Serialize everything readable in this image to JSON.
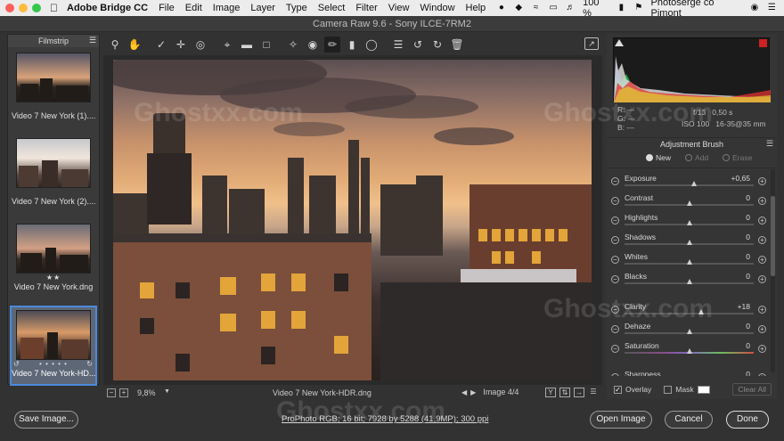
{
  "menubar": {
    "app_name": "Adobe Bridge CC",
    "items": [
      "File",
      "Edit",
      "Image",
      "Layer",
      "Type",
      "Select",
      "Filter",
      "View",
      "Window",
      "Help"
    ],
    "battery": "100 %",
    "user": "Photoserge co Pimont"
  },
  "window": {
    "title": "Camera Raw 9.6  -  Sony ILCE-7RM2"
  },
  "filmstrip": {
    "title": "Filmstrip",
    "items": [
      {
        "label": "Video 7 New York (1)....",
        "stars": ""
      },
      {
        "label": "Video 7 New York (2)....",
        "stars": ""
      },
      {
        "label": "Video 7 New York.dng",
        "stars": "★★"
      },
      {
        "label": "Video 7 New York-HD...",
        "stars": "• • • • •",
        "selected": true
      }
    ]
  },
  "toolbar": {
    "tools": [
      "zoom-icon",
      "hand-icon",
      "white-balance-icon",
      "color-sampler-icon",
      "targeted-adjust-icon",
      "crop-icon",
      "straighten-icon",
      "transform-icon",
      "spot-removal-icon",
      "red-eye-icon",
      "adjustment-brush-icon",
      "graduated-filter-icon",
      "radial-filter-icon",
      "preferences-icon",
      "rotate-ccw-icon",
      "rotate-cw-icon",
      "trash-icon"
    ]
  },
  "readout": {
    "r": "R:  ---",
    "g": "G:  ---",
    "b": "B:  ---",
    "aperture": "f/13",
    "shutter": "0,50 s",
    "iso": "ISO 100",
    "lens": "16-35@35 mm"
  },
  "panel": {
    "title": "Adjustment Brush",
    "modes": [
      {
        "label": "New",
        "on": true
      },
      {
        "label": "Add",
        "on": false
      },
      {
        "label": "Erase",
        "on": false
      }
    ],
    "sliders": [
      {
        "name": "Exposure",
        "value": "+0,65",
        "pos": 0.54
      },
      {
        "name": "Contrast",
        "value": "0",
        "pos": 0.5
      },
      {
        "name": "Highlights",
        "value": "0",
        "pos": 0.5
      },
      {
        "name": "Shadows",
        "value": "0",
        "pos": 0.5
      },
      {
        "name": "Whites",
        "value": "0",
        "pos": 0.5
      },
      {
        "name": "Blacks",
        "value": "0",
        "pos": 0.5
      },
      {
        "name": "Clarity",
        "value": "+18",
        "pos": 0.59
      },
      {
        "name": "Dehaze",
        "value": "0",
        "pos": 0.5
      },
      {
        "name": "Saturation",
        "value": "0",
        "pos": 0.5
      },
      {
        "name": "Sharpness",
        "value": "0",
        "pos": 0.5
      }
    ],
    "overlay_label": "Overlay",
    "mask_label": "Mask",
    "clear_all": "Clear All"
  },
  "status": {
    "zoom": "9,8%",
    "filename": "Video 7 New York-HDR.dng",
    "image_count": "Image 4/4",
    "view_toggle": "Y"
  },
  "bottom": {
    "save_label": "Save Image...",
    "workflow": "ProPhoto RGB; 16 bit; 7928 by 5288 (41,9MP); 300 ppi",
    "open_label": "Open Image",
    "cancel_label": "Cancel",
    "done_label": "Done"
  },
  "watermark": "Ghostxx.com",
  "colors": {
    "accent": "#4a89dc",
    "panel": "#353535",
    "background": "#323232"
  }
}
